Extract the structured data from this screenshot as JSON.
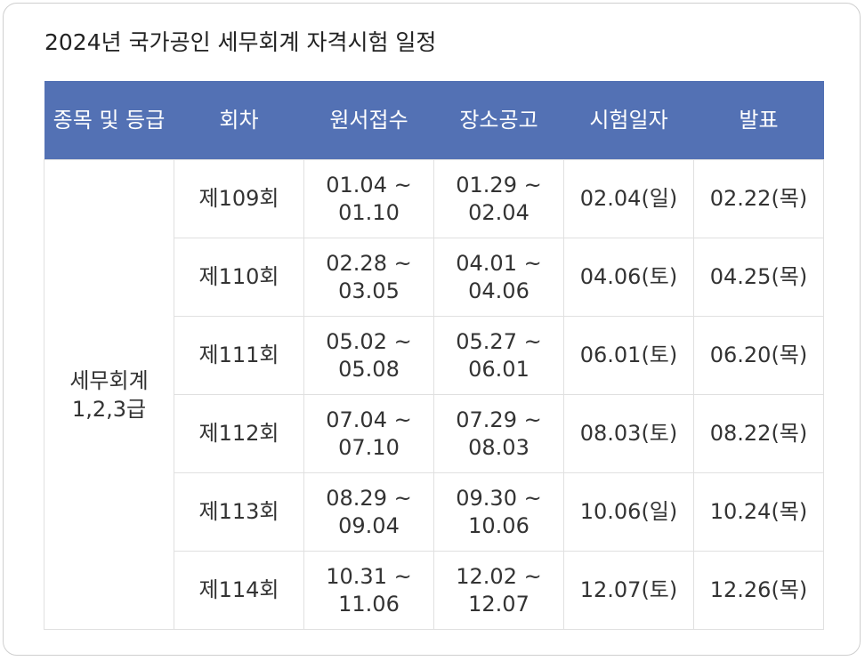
{
  "title": "2024년 국가공인 세무회계 자격시험 일정",
  "headers": {
    "category": "종목 및 등급",
    "round": "회차",
    "application": "원서접수",
    "venue_notice": "장소공고",
    "exam_date": "시험일자",
    "result": "발표"
  },
  "category": {
    "line1": "세무회계",
    "line2": "1,2,3급"
  },
  "rows": [
    {
      "round": "제109회",
      "apply_start": "01.04 ~",
      "apply_end": "01.10",
      "venue_start": "01.29 ~",
      "venue_end": "02.04",
      "exam": "02.04(일)",
      "exam_day_type": "sunday",
      "result": "02.22(목)"
    },
    {
      "round": "제110회",
      "apply_start": "02.28 ~",
      "apply_end": "03.05",
      "venue_start": "04.01 ~",
      "venue_end": "04.06",
      "exam": "04.06(토)",
      "exam_day_type": "saturday",
      "result": "04.25(목)"
    },
    {
      "round": "제111회",
      "apply_start": "05.02 ~",
      "apply_end": "05.08",
      "venue_start": "05.27 ~",
      "venue_end": "06.01",
      "exam": "06.01(토)",
      "exam_day_type": "saturday",
      "result": "06.20(목)"
    },
    {
      "round": "제112회",
      "apply_start": "07.04 ~",
      "apply_end": "07.10",
      "venue_start": "07.29 ~",
      "venue_end": "08.03",
      "exam": "08.03(토)",
      "exam_day_type": "saturday",
      "result": "08.22(목)"
    },
    {
      "round": "제113회",
      "apply_start": "08.29 ~",
      "apply_end": "09.04",
      "venue_start": "09.30 ~",
      "venue_end": "10.06",
      "exam": "10.06(일)",
      "exam_day_type": "sunday",
      "result": "10.24(목)"
    },
    {
      "round": "제114회",
      "apply_start": "10.31 ~",
      "apply_end": "11.06",
      "venue_start": "12.02 ~",
      "venue_end": "12.07",
      "exam": "12.07(토)",
      "exam_day_type": "saturday",
      "result": "12.26(목)"
    }
  ],
  "colors": {
    "header_bg": "#5371b4",
    "sunday": "#cc1e1e",
    "saturday": "#4474b0"
  }
}
